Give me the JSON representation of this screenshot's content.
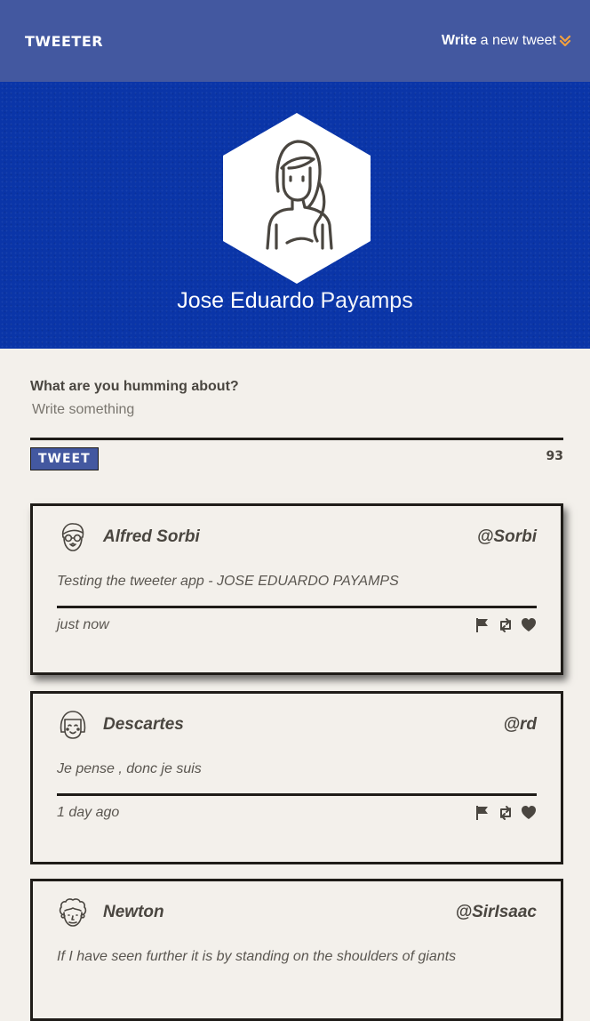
{
  "nav": {
    "brand": "TWEETER",
    "compose_strong": "Write",
    "compose_rest": "a new tweet",
    "accent": "#f0a040"
  },
  "profile": {
    "first_name": "Jose Eduardo",
    "last_name": "Payamps",
    "banner_color": "#0a35a8"
  },
  "compose": {
    "label": "What are you humming about?",
    "placeholder": "Write something",
    "value": "",
    "button_label": "TWEET",
    "char_count": "93"
  },
  "tweets": [
    {
      "name": "Alfred Sorbi",
      "handle": "@Sorbi",
      "text": "Testing the tweeter app - JOSE EDUARDO PAYAMPS",
      "time": "just now",
      "avatar_icon": "glasses-man-avatar-icon"
    },
    {
      "name": "Descartes",
      "handle": "@rd",
      "text": "Je pense , donc je suis",
      "time": "1 day ago",
      "avatar_icon": "bob-hair-avatar-icon"
    },
    {
      "name": "Newton",
      "handle": "@SirIsaac",
      "text": "If I have seen further it is by standing on the shoulders of giants",
      "time": "",
      "avatar_icon": "curly-hair-avatar-icon"
    }
  ],
  "actions": [
    "flag-icon",
    "retweet-icon",
    "heart-icon"
  ]
}
